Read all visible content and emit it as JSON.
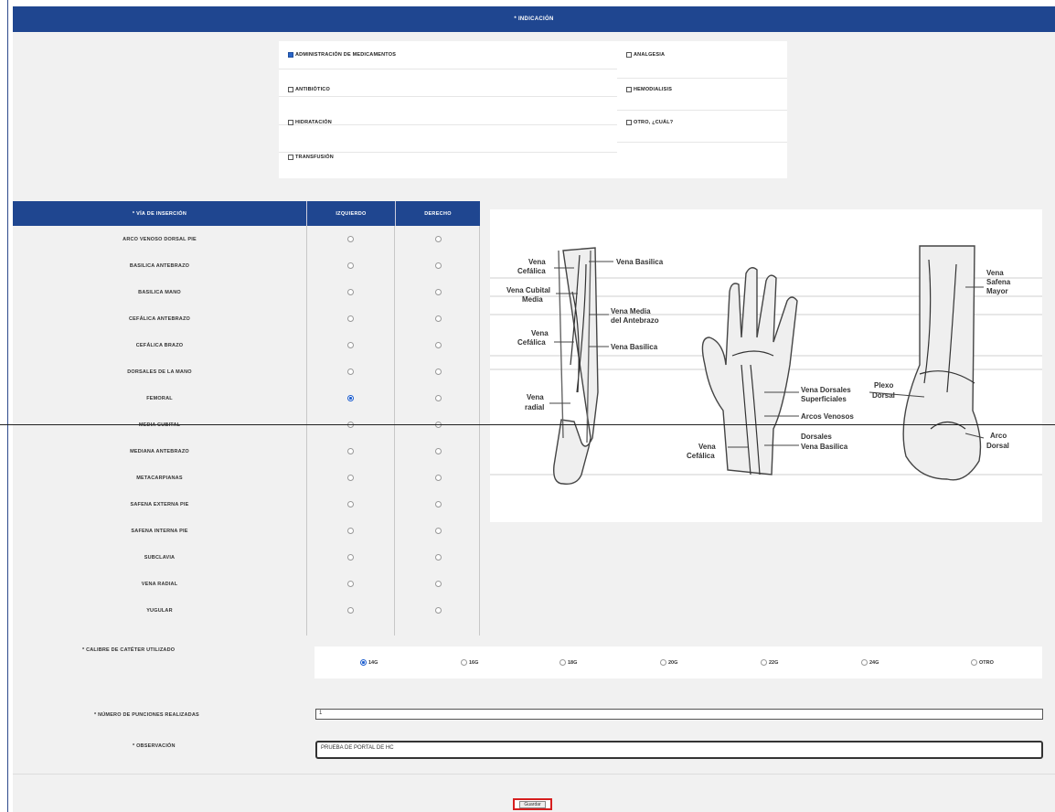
{
  "indicacion": {
    "header": "* INDICACIÓN",
    "options": [
      {
        "label": "ADMINISTRACIÓN DE MEDICAMENTOS",
        "checked": true
      },
      {
        "label": "ANALGESIA",
        "checked": false
      },
      {
        "label": "ANTIBIÓTICO",
        "checked": false
      },
      {
        "label": "HEMODIALISIS",
        "checked": false
      },
      {
        "label": "HIDRATACIÓN",
        "checked": false
      },
      {
        "label": "OTRO, ¿CUÁL?",
        "checked": false
      },
      {
        "label": "TRANSFUSIÓN",
        "checked": false
      }
    ]
  },
  "via": {
    "header": "* VÍA DE INSERCIÓN",
    "col_left": "IZQUIERDO",
    "col_right": "DERECHO",
    "rows": [
      {
        "name": "ARCO VENOSO DORSAL PIE",
        "left": false,
        "right": false
      },
      {
        "name": "BASILICA ANTEBRAZO",
        "left": false,
        "right": false
      },
      {
        "name": "BASILICA MANO",
        "left": false,
        "right": false
      },
      {
        "name": "CEFÁLICA ANTEBRAZO",
        "left": false,
        "right": false
      },
      {
        "name": "CEFÁLICA BRAZO",
        "left": false,
        "right": false
      },
      {
        "name": "DORSALES DE LA MANO",
        "left": false,
        "right": false
      },
      {
        "name": "FEMORAL",
        "left": true,
        "right": false
      },
      {
        "name": "MEDIA CUBITAL",
        "left": false,
        "right": false
      },
      {
        "name": "MEDIANA ANTEBRAZO",
        "left": false,
        "right": false
      },
      {
        "name": "METACARPIANAS",
        "left": false,
        "right": false
      },
      {
        "name": "SAFENA EXTERNA PIE",
        "left": false,
        "right": false
      },
      {
        "name": "SAFENA INTERNA PIE",
        "left": false,
        "right": false
      },
      {
        "name": "SUBCLAVIA",
        "left": false,
        "right": false
      },
      {
        "name": "VENA RADIAL",
        "left": false,
        "right": false
      },
      {
        "name": "YUGULAR",
        "left": false,
        "right": false
      }
    ]
  },
  "diagram": {
    "labels": {
      "vena_cefalica_1": [
        "Vena",
        "Cefálica"
      ],
      "vena_basilica_1": "Vena Basilica",
      "vena_cubital_media": [
        "Vena Cubital",
        "Media"
      ],
      "vena_media_antebrazo": [
        "Vena Media",
        "del Antebrazo"
      ],
      "vena_cefalica_2": [
        "Vena",
        "Cefálica"
      ],
      "vena_basilica_2": "Vena Basilica",
      "vena_radial": [
        "Vena",
        "radial"
      ],
      "venas_dorsales": [
        "Vena Dorsales",
        "Superficiales"
      ],
      "arcos_venosos": "Arcos Venosos",
      "dorsales": "Dorsales",
      "vena_basilica_3": "Vena Basilica",
      "vena_cefalica_3": [
        "Vena",
        "Cefálica"
      ],
      "plexo_dorsal": [
        "Plexo",
        "Dorsal"
      ],
      "vena_safena_mayor": [
        "Vena",
        "Safena",
        "Mayor"
      ],
      "arco_dorsal": [
        "Arco",
        "Dorsal"
      ]
    }
  },
  "calibre": {
    "label": "* CALIBRE DE CATÉTER UTILIZADO",
    "options": [
      {
        "label": "14G",
        "selected": true
      },
      {
        "label": "16G",
        "selected": false
      },
      {
        "label": "18G",
        "selected": false
      },
      {
        "label": "20G",
        "selected": false
      },
      {
        "label": "22G",
        "selected": false
      },
      {
        "label": "24G",
        "selected": false
      },
      {
        "label": "OTRO",
        "selected": false
      }
    ]
  },
  "punciones": {
    "label": "* NÚMERO DE PUNCIONES REALIZADAS",
    "value": "1"
  },
  "observacion": {
    "label": "* OBSERVACIÓN",
    "value": "PRUEBA DE PORTAL DE HC"
  },
  "submit_label": "Guardar"
}
